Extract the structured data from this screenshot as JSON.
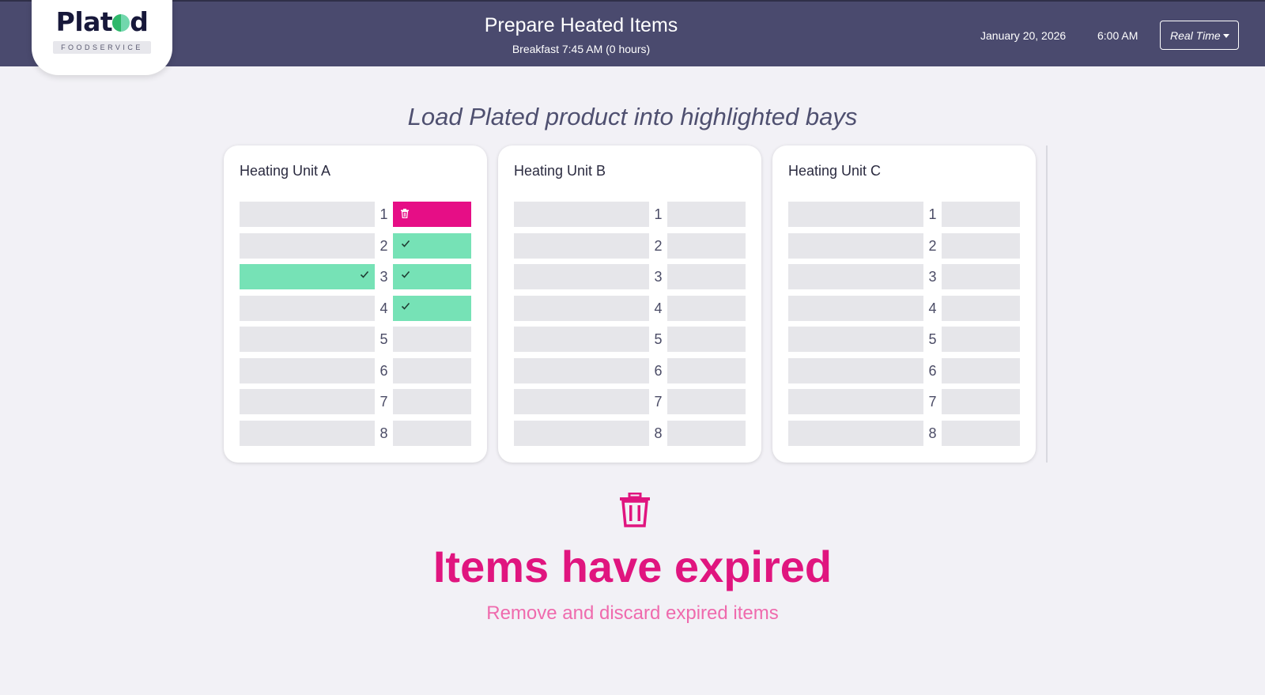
{
  "brand": {
    "name_pre": "Plat",
    "name_post": "d",
    "tagline": "FOODSERVICE"
  },
  "header": {
    "title": "Prepare Heated Items",
    "subtitle": "Breakfast 7:45 AM (0 hours)",
    "date": "January 20, 2026",
    "time": "6:00 AM",
    "mode_label": "Real Time"
  },
  "instruction": "Load Plated product into highlighted bays",
  "units": [
    {
      "title": "Heating Unit A",
      "rows": [
        {
          "num": "1",
          "left": "empty",
          "right": "expired"
        },
        {
          "num": "2",
          "left": "empty",
          "right": "filled"
        },
        {
          "num": "3",
          "left": "filled",
          "right": "filled"
        },
        {
          "num": "4",
          "left": "empty",
          "right": "filled"
        },
        {
          "num": "5",
          "left": "empty",
          "right": "empty"
        },
        {
          "num": "6",
          "left": "empty",
          "right": "empty"
        },
        {
          "num": "7",
          "left": "empty",
          "right": "empty"
        },
        {
          "num": "8",
          "left": "empty",
          "right": "empty"
        }
      ]
    },
    {
      "title": "Heating Unit B",
      "rows": [
        {
          "num": "1",
          "left": "empty",
          "right": "empty"
        },
        {
          "num": "2",
          "left": "empty",
          "right": "empty"
        },
        {
          "num": "3",
          "left": "empty",
          "right": "empty"
        },
        {
          "num": "4",
          "left": "empty",
          "right": "empty"
        },
        {
          "num": "5",
          "left": "empty",
          "right": "empty"
        },
        {
          "num": "6",
          "left": "empty",
          "right": "empty"
        },
        {
          "num": "7",
          "left": "empty",
          "right": "empty"
        },
        {
          "num": "8",
          "left": "empty",
          "right": "empty"
        }
      ]
    },
    {
      "title": "Heating Unit C",
      "rows": [
        {
          "num": "1",
          "left": "empty",
          "right": "empty"
        },
        {
          "num": "2",
          "left": "empty",
          "right": "empty"
        },
        {
          "num": "3",
          "left": "empty",
          "right": "empty"
        },
        {
          "num": "4",
          "left": "empty",
          "right": "empty"
        },
        {
          "num": "5",
          "left": "empty",
          "right": "empty"
        },
        {
          "num": "6",
          "left": "empty",
          "right": "empty"
        },
        {
          "num": "7",
          "left": "empty",
          "right": "empty"
        },
        {
          "num": "8",
          "left": "empty",
          "right": "empty"
        }
      ]
    }
  ],
  "alert": {
    "icon": "trash-icon",
    "title": "Items have expired",
    "message": "Remove and discard expired items"
  },
  "colors": {
    "header_bg": "#4a4a6e",
    "filled": "#76e2b6",
    "expired": "#e60e86",
    "empty": "#e6e6ea",
    "alert": "#e0157f"
  }
}
